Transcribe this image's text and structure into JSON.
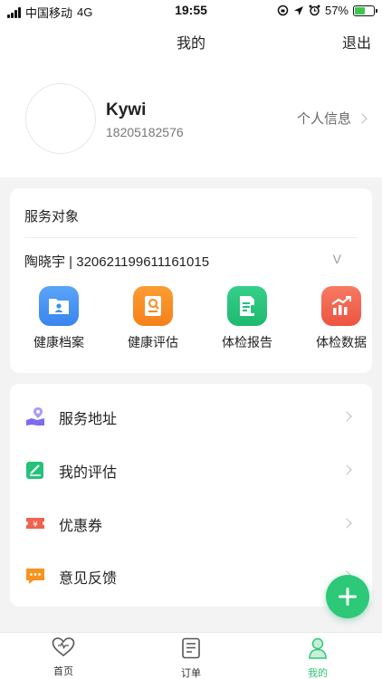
{
  "status_bar": {
    "carrier": "中国移动",
    "network": "4G",
    "time": "19:55",
    "battery_percent": "57%",
    "battery_level": 0.57
  },
  "header": {
    "title": "我的",
    "logout_label": "退出"
  },
  "profile": {
    "name": "Kywi",
    "phone": "18205182576",
    "personal_info_label": "个人信息"
  },
  "service": {
    "title": "服务对象",
    "person": "陶晓宇 | 320621199611161015",
    "dropdown_symbol": "V",
    "items": [
      {
        "label": "健康档案",
        "icon": "folder-user-icon",
        "color": "#3d8ef0"
      },
      {
        "label": "健康评估",
        "icon": "assessment-icon",
        "color": "#f78a1e"
      },
      {
        "label": "体检报告",
        "icon": "report-icon",
        "color": "#26c27a"
      },
      {
        "label": "体检数据",
        "icon": "chart-icon",
        "color": "#f0624f"
      }
    ]
  },
  "menu": {
    "items": [
      {
        "label": "服务地址",
        "icon": "map-pin-icon",
        "color": "#7b6cf0"
      },
      {
        "label": "我的评估",
        "icon": "edit-icon",
        "color": "#26c27a"
      },
      {
        "label": "优惠券",
        "icon": "coupon-icon",
        "color": "#f0624f"
      },
      {
        "label": "意见反馈",
        "icon": "feedback-icon",
        "color": "#f7931e"
      }
    ]
  },
  "tabbar": {
    "items": [
      {
        "label": "首页",
        "icon": "heart-icon"
      },
      {
        "label": "订单",
        "icon": "order-icon"
      },
      {
        "label": "我的",
        "icon": "user-icon",
        "active": true
      }
    ]
  },
  "colors": {
    "accent": "#2dc878"
  }
}
